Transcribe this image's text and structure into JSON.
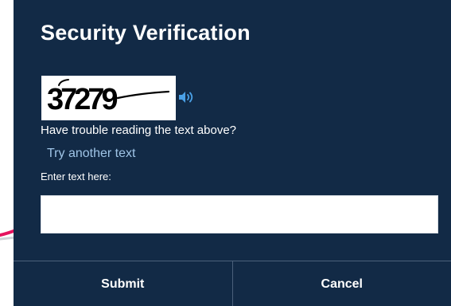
{
  "dialog": {
    "title": "Security Verification",
    "captcha_text": "37279",
    "audio_icon": "speaker-icon",
    "trouble_text": "Have trouble reading the text above?",
    "try_another_label": "Try another text",
    "input_label": "Enter text here:",
    "input_value": "",
    "input_placeholder": ""
  },
  "footer": {
    "submit_label": "Submit",
    "cancel_label": "Cancel"
  },
  "colors": {
    "dialog_background": "#122a46",
    "link": "#9fc4e6",
    "audio_icon": "#4aa0e6",
    "pointer_accent": "#e5135f"
  }
}
